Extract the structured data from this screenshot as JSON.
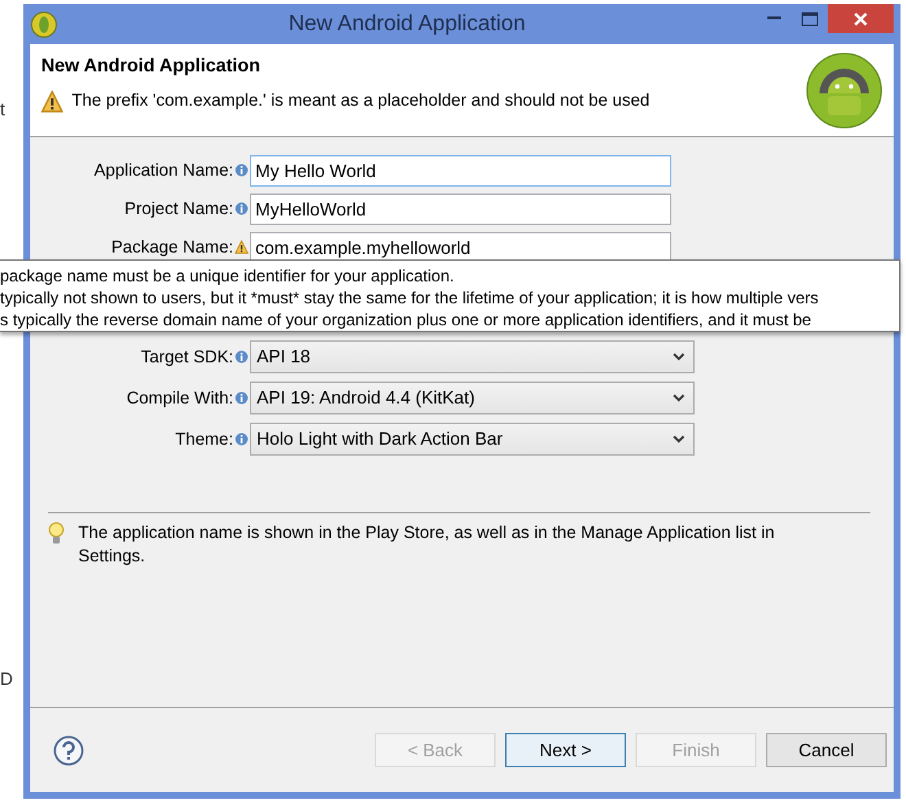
{
  "background": {
    "texts": [
      "t",
      "D"
    ]
  },
  "window": {
    "title": "New Android Application"
  },
  "header": {
    "title": "New Android Application",
    "message": "The prefix 'com.example.' is meant as a placeholder and should not be used",
    "warning": true
  },
  "fields": [
    {
      "label": "Application Name:",
      "kind": "text",
      "value": "My Hello World",
      "focused": true,
      "warning": false
    },
    {
      "label": "Project Name:",
      "kind": "text",
      "value": "MyHelloWorld",
      "focused": false,
      "warning": false
    },
    {
      "label": "Package Name:",
      "kind": "text",
      "value": "com.example.myhelloworld",
      "focused": false,
      "warning": true
    },
    {
      "label": "Target SDK:",
      "kind": "select",
      "value": "API 18",
      "focused": false,
      "warning": false
    },
    {
      "label": "Compile With:",
      "kind": "select",
      "value": "API 19: Android 4.4 (KitKat)",
      "focused": false,
      "warning": false
    },
    {
      "label": "Theme:",
      "kind": "select",
      "value": "Holo Light with Dark Action Bar",
      "focused": false,
      "warning": false
    }
  ],
  "tooltip": {
    "lines": [
      "package name must be a unique identifier for your application.",
      "typically not shown to users, but it *must* stay the same for the lifetime of your application; it is how multiple vers",
      "s typically the reverse domain name of your organization plus one or more application identifiers, and it must be"
    ]
  },
  "tip": {
    "text": "The application name is shown in the Play Store, as well as in the Manage Application list in Settings."
  },
  "buttons": [
    {
      "label": "< Back",
      "disabled": true,
      "default": false
    },
    {
      "label": "Next >",
      "disabled": false,
      "default": true
    },
    {
      "label": "Finish",
      "disabled": true,
      "default": false
    },
    {
      "label": "Cancel",
      "disabled": false,
      "default": false
    }
  ]
}
